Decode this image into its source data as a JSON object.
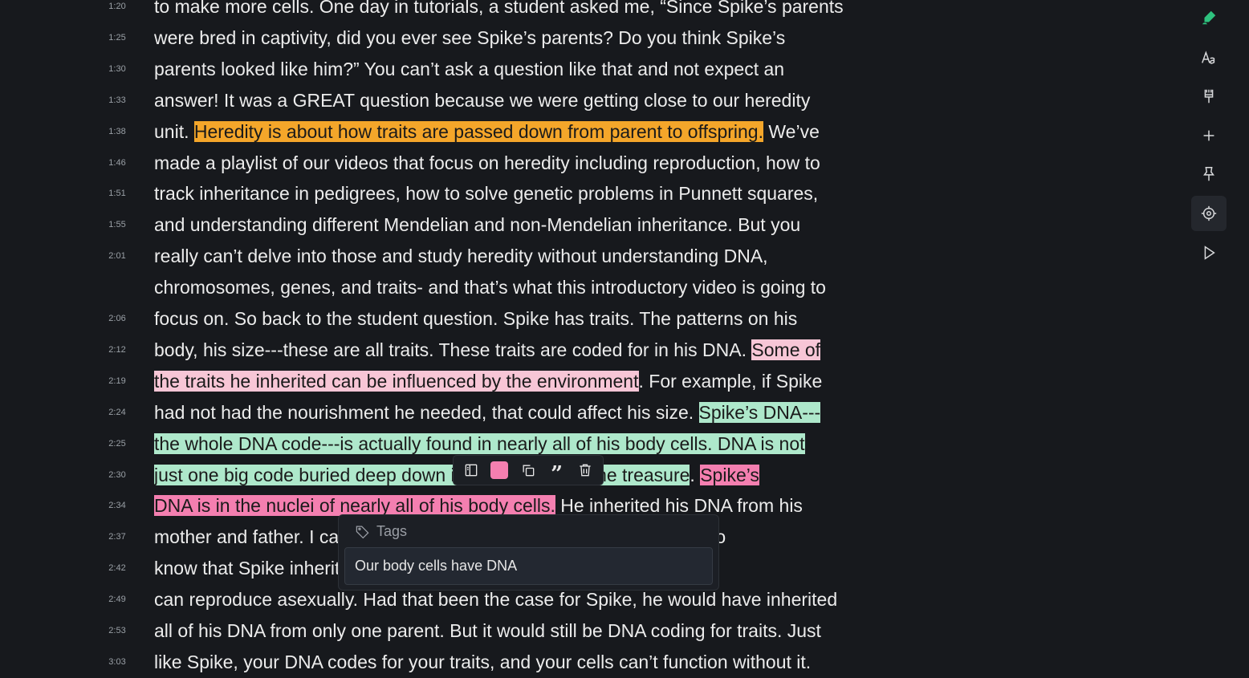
{
  "transcript": [
    {
      "ts": "1:20",
      "segs": [
        {
          "t": "to make more cells. One day in tutorials, a student asked me, “Since Spike’s parents",
          "hl": ""
        }
      ]
    },
    {
      "ts": "1:25",
      "segs": [
        {
          "t": "were bred in captivity, did you ever see Spike’s parents? Do you think Spike’s",
          "hl": ""
        }
      ]
    },
    {
      "ts": "1:30",
      "segs": [
        {
          "t": "parents looked like him?” You can’t ask a question like that and not expect an",
          "hl": ""
        }
      ]
    },
    {
      "ts": "1:33",
      "segs": [
        {
          "t": "answer! It was a GREAT question because we were getting close to our heredity",
          "hl": ""
        }
      ]
    },
    {
      "ts": "1:38",
      "segs": [
        {
          "t": "unit. ",
          "hl": ""
        },
        {
          "t": "Heredity is about how traits are passed down from parent to offspring.",
          "hl": "orange"
        },
        {
          "t": " We’ve",
          "hl": ""
        }
      ]
    },
    {
      "ts": "1:46",
      "segs": [
        {
          "t": "made a playlist of our videos that focus on heredity including reproduction, how to",
          "hl": ""
        }
      ]
    },
    {
      "ts": "1:51",
      "segs": [
        {
          "t": "track inheritance in pedigrees, how to solve genetic problems in Punnett squares,",
          "hl": ""
        }
      ]
    },
    {
      "ts": "1:55",
      "segs": [
        {
          "t": "and understanding different Mendelian and non-Mendelian inheritance. But you",
          "hl": ""
        }
      ]
    },
    {
      "ts": "2:01",
      "segs": [
        {
          "t": "really can’t delve into those and study heredity without understanding DNA,",
          "hl": ""
        }
      ]
    },
    {
      "ts": "",
      "segs": [
        {
          "t": "chromosomes, genes, and traits- and that’s what this introductory video is going to",
          "hl": ""
        }
      ]
    },
    {
      "ts": "2:06",
      "segs": [
        {
          "t": "focus on. So back to the student question. Spike has traits. The patterns on his",
          "hl": ""
        }
      ]
    },
    {
      "ts": "2:12",
      "segs": [
        {
          "t": "body, his size---these are all traits. These traits are coded for in his DNA. ",
          "hl": ""
        },
        {
          "t": "Some of",
          "hl": "pink"
        }
      ]
    },
    {
      "ts": "2:19",
      "segs": [
        {
          "t": "the traits he inherited can be influenced by the environment",
          "hl": "pink"
        },
        {
          "t": ". For example, if Spike",
          "hl": ""
        }
      ]
    },
    {
      "ts": "2:24",
      "segs": [
        {
          "t": "had not had the nourishment he needed, that could affect his size. ",
          "hl": ""
        },
        {
          "t": "Spike’s DNA---",
          "hl": "green"
        }
      ]
    },
    {
      "ts": "2:25",
      "segs": [
        {
          "t": "the whole DNA code---is actually found in nearly all of his body cells. DNA is not",
          "hl": "green"
        }
      ]
    },
    {
      "ts": "2:30",
      "segs": [
        {
          "t": "just one big code buried deep down in one cell like some treasure",
          "hl": "green"
        },
        {
          "t": ". ",
          "hl": ""
        },
        {
          "t": "Spike’s",
          "hl": "hotpink"
        }
      ]
    },
    {
      "ts": "2:34",
      "segs": [
        {
          "t": "DNA is in the nuclei of nearly all of his body cells.",
          "hl": "hotpink"
        },
        {
          "t": " He inherited his DNA from his",
          "hl": ""
        }
      ]
    },
    {
      "ts": "2:37",
      "segs": [
        {
          "t": "mother and father. I can’t tell you what his parents looked like, but I do",
          "hl": ""
        }
      ]
    },
    {
      "ts": "2:42",
      "segs": [
        {
          "t": "know that Spike inherited DNA from both. Some snake species",
          "hl": ""
        }
      ]
    },
    {
      "ts": "2:49",
      "segs": [
        {
          "t": "can reproduce asexually. Had that been the case for Spike, he would have inherited",
          "hl": ""
        }
      ]
    },
    {
      "ts": "2:53",
      "segs": [
        {
          "t": "all of his DNA from only one parent. But it would still be DNA coding for traits. Just",
          "hl": ""
        }
      ]
    },
    {
      "ts": "3:03",
      "segs": [
        {
          "t": "like Spike, your DNA codes for your traits, and your cells can’t function without it.",
          "hl": ""
        }
      ]
    }
  ],
  "highlight_colors": {
    "orange": "#f4a62a",
    "pink": "#f7c6d6",
    "green": "#aee8cb",
    "hotpink": "#f47fb0"
  },
  "annotation_toolbar": {
    "icons": [
      "sidebar-icon",
      "color-swatch",
      "copy-icon",
      "quote-icon",
      "trash-icon"
    ],
    "swatch_color": "#f47fb0"
  },
  "tags_popup": {
    "label": "Tags",
    "tag": "Our body cells have DNA"
  },
  "right_toolbar": {
    "icons": [
      "highlighter-icon",
      "font-size-icon",
      "brush-icon",
      "plus-icon",
      "pin-icon",
      "target-icon",
      "play-icon"
    ],
    "active": "target-icon"
  }
}
